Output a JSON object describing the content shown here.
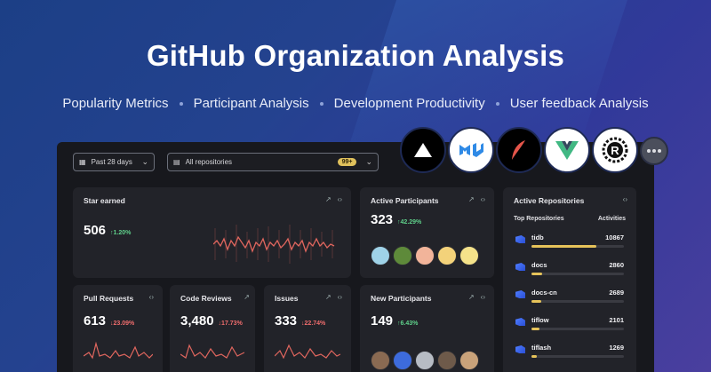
{
  "hero": {
    "title": "GitHub Organization Analysis"
  },
  "subnav": [
    "Popularity Metrics",
    "Participant Analysis",
    "Development Productivity",
    "User feedback Analysis"
  ],
  "filters": {
    "period": "Past 28 days",
    "repositories": "All repositories",
    "repo_count": "99+"
  },
  "logos": [
    "vercel-logo-icon",
    "mui-logo-icon",
    "feather-logo-icon",
    "vue-logo-icon",
    "rust-logo-icon",
    "more-icon"
  ],
  "cards": {
    "stars": {
      "title": "Star earned",
      "value": "506",
      "delta": "↑1.20%"
    },
    "active_participants": {
      "title": "Active Participants",
      "value": "323",
      "delta": "↑42.29%"
    },
    "pull_requests": {
      "title": "Pull Requests",
      "value": "613",
      "delta": "↓23.09%"
    },
    "code_reviews": {
      "title": "Code Reviews",
      "value": "3,480",
      "delta": "↓17.73%"
    },
    "issues": {
      "title": "Issues",
      "value": "333",
      "delta": "↓22.74%"
    },
    "new_participants": {
      "title": "New Participants",
      "value": "149",
      "delta": "↑6.43%"
    }
  },
  "active_repositories": {
    "title": "Active Repositories",
    "col_repo": "Top Repositories",
    "col_activity": "Activities",
    "rows": [
      {
        "name": "tidb",
        "value": "10867",
        "fraction": 0.7
      },
      {
        "name": "docs",
        "value": "2860",
        "fraction": 0.12
      },
      {
        "name": "docs-cn",
        "value": "2689",
        "fraction": 0.11
      },
      {
        "name": "tiflow",
        "value": "2101",
        "fraction": 0.09
      },
      {
        "name": "tiflash",
        "value": "1269",
        "fraction": 0.06
      }
    ]
  },
  "colors": {
    "accent_yellow": "#e6c35a",
    "up_green": "#5fd08a",
    "down_red": "#ef6d6d",
    "spark_red": "#e0665e"
  }
}
